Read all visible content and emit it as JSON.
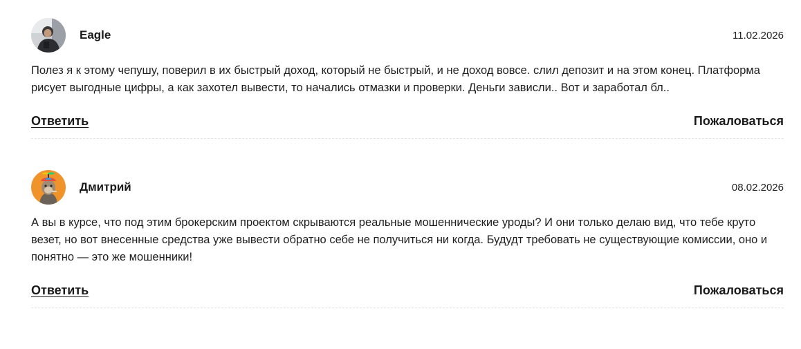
{
  "comments": [
    {
      "author": "Eagle",
      "date": "11.02.2026",
      "text": "Полез я к этому чепушу, поверил в их быстрый доход, который не быстрый, и не доход вовсе. слил депозит и на этом конец. Платформа рисует выгодные цифры, а как захотел вывести, то начались отмазки и проверки. Деньги зависли.. Вот и заработал бл..",
      "reply_label": "Ответить",
      "report_label": "Пожаловаться"
    },
    {
      "author": "Дмитрий",
      "date": "08.02.2026",
      "text": "А вы в курсе, что под этим брокерским проектом скрываются реальные мошеннические уроды? И они только делаю вид, что тебе круто везет, но вот внесенные средства уже вывести обратно себе не получиться ни когда. Будудт требовать не существующие комиссии, оно и понятно — это же мошенники!",
      "reply_label": "Ответить",
      "report_label": "Пожаловаться"
    }
  ],
  "colors": {
    "text": "#1a1a1a",
    "divider": "#e3e3e3",
    "avatar2_bg": "#f0932b"
  },
  "icons": {
    "avatar1": "user-photo-avatar",
    "avatar2": "cartoon-ape-avatar"
  }
}
